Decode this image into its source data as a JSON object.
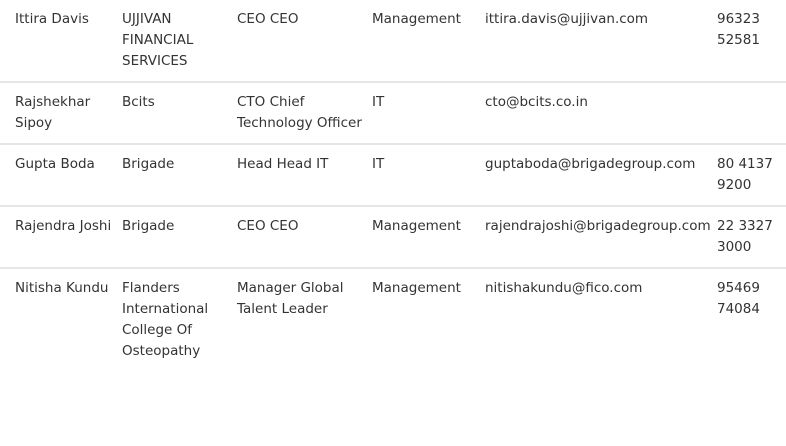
{
  "rows": [
    {
      "name": "Ittira Davis",
      "company": "UJJIVAN FINANCIAL SERVICES",
      "title": "CEO CEO",
      "department": "Management",
      "email": "ittira.davis@ujjivan.com",
      "phone": "96323 52581"
    },
    {
      "name": "Rajshekhar Sipoy",
      "company": "Bcits",
      "title": "CTO Chief Technology Officer",
      "department": "IT",
      "email": "cto@bcits.co.in",
      "phone": ""
    },
    {
      "name": "Gupta Boda",
      "company": "Brigade",
      "title": "Head Head IT",
      "department": "IT",
      "email": "guptaboda@brigadegroup.com",
      "phone": "80 4137 9200"
    },
    {
      "name": "Rajendra Joshi",
      "company": "Brigade",
      "title": "CEO CEO",
      "department": "Management",
      "email": "rajendrajoshi@brigadegroup.com",
      "phone": "22 3327 3000"
    },
    {
      "name": "Nitisha Kundu",
      "company": "Flanders International College Of Osteopathy",
      "title": "Manager Global Talent Leader",
      "department": "Management",
      "email": "nitishakundu@fico.com",
      "phone": "95469 74084"
    }
  ]
}
